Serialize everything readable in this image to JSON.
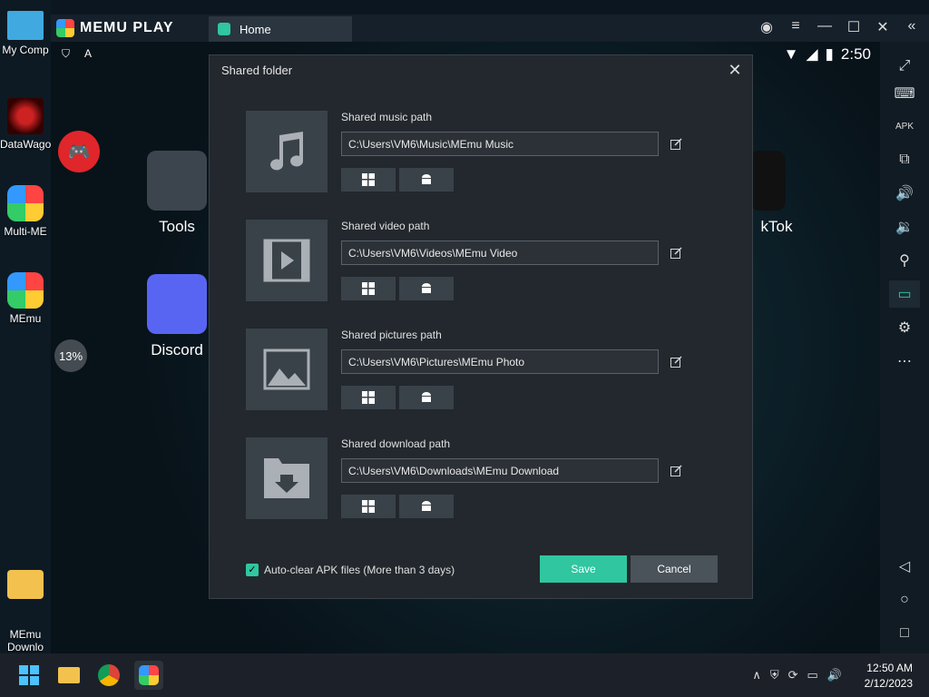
{
  "desktop": {
    "icons": [
      {
        "label": "My Comp"
      },
      {
        "label": "DataWago"
      },
      {
        "label": "Multi-ME"
      },
      {
        "label": "MEmu"
      },
      {
        "label": "MEmu\nDownlo"
      }
    ]
  },
  "memu": {
    "brand": "MEMU PLAY",
    "tab": "Home",
    "status_time": "2:50",
    "loading_pct": "13%",
    "apps": [
      {
        "label": "Tools"
      },
      {
        "label": "Discord"
      },
      {
        "label": "kTok"
      }
    ]
  },
  "dialog": {
    "title": "Shared folder",
    "rows": [
      {
        "label": "Shared music path",
        "value": "C:\\Users\\VM6\\Music\\MEmu Music",
        "icon": "music-note-icon"
      },
      {
        "label": "Shared video path",
        "value": "C:\\Users\\VM6\\Videos\\MEmu Video",
        "icon": "video-film-icon"
      },
      {
        "label": "Shared pictures path",
        "value": "C:\\Users\\VM6\\Pictures\\MEmu Photo",
        "icon": "picture-icon"
      },
      {
        "label": "Shared download path",
        "value": "C:\\Users\\VM6\\Downloads\\MEmu Download",
        "icon": "download-folder-icon"
      }
    ],
    "autoclear_label": "Auto-clear APK files (More than 3 days)",
    "save_label": "Save",
    "cancel_label": "Cancel"
  },
  "taskbar": {
    "time": "12:50 AM",
    "date": "2/12/2023"
  },
  "colors": {
    "accent": "#2fc6a0",
    "dialog_bg": "#22282d",
    "button_secondary": "#4a525a"
  }
}
